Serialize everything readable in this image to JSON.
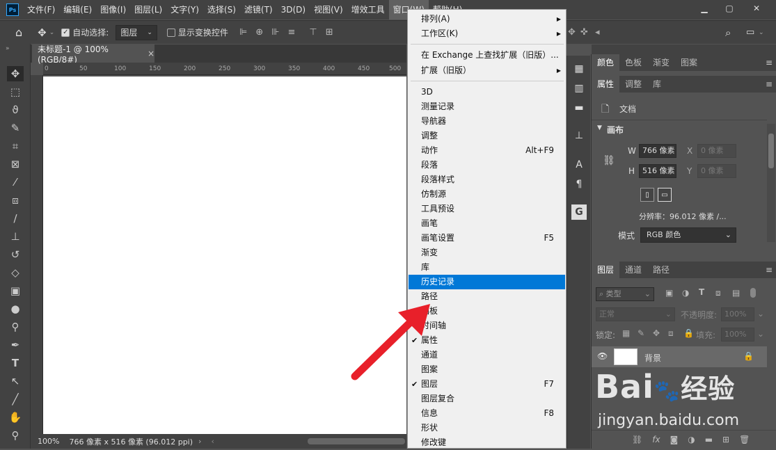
{
  "app": {
    "logo": "Ps"
  },
  "menubar": [
    "文件(F)",
    "编辑(E)",
    "图像(I)",
    "图层(L)",
    "文字(Y)",
    "选择(S)",
    "滤镜(T)",
    "3D(D)",
    "视图(V)",
    "增效工具",
    "窗口(W)",
    "帮助(H)"
  ],
  "options": {
    "auto_select_label": "自动选择:",
    "auto_select_value": "图层",
    "show_transform_label": "显示变换控件"
  },
  "document": {
    "tab_title": "未标题-1 @ 100%(RGB/8#)",
    "zoom": "100%",
    "info": "766 像素 x 516 像素 (96.012 ppi)"
  },
  "ruler": [
    "0",
    "50",
    "100",
    "150",
    "200",
    "250",
    "300",
    "350",
    "400",
    "450",
    "500"
  ],
  "window_menu": {
    "items": [
      {
        "label": "排列(A)",
        "shortcut": "",
        "submenu": true,
        "checked": false
      },
      {
        "label": "工作区(K)",
        "shortcut": "",
        "submenu": true,
        "checked": false
      },
      {
        "label": "在 Exchange 上查找扩展（旧版）...",
        "shortcut": "",
        "submenu": false,
        "checked": false
      },
      {
        "label": "扩展（旧版）",
        "shortcut": "",
        "submenu": true,
        "checked": false
      },
      {
        "label": "3D",
        "shortcut": "",
        "submenu": false,
        "checked": false
      },
      {
        "label": "测量记录",
        "shortcut": "",
        "submenu": false,
        "checked": false
      },
      {
        "label": "导航器",
        "shortcut": "",
        "submenu": false,
        "checked": false
      },
      {
        "label": "调整",
        "shortcut": "",
        "submenu": false,
        "checked": false
      },
      {
        "label": "动作",
        "shortcut": "Alt+F9",
        "submenu": false,
        "checked": false
      },
      {
        "label": "段落",
        "shortcut": "",
        "submenu": false,
        "checked": false
      },
      {
        "label": "段落样式",
        "shortcut": "",
        "submenu": false,
        "checked": false
      },
      {
        "label": "仿制源",
        "shortcut": "",
        "submenu": false,
        "checked": false
      },
      {
        "label": "工具预设",
        "shortcut": "",
        "submenu": false,
        "checked": false
      },
      {
        "label": "画笔",
        "shortcut": "",
        "submenu": false,
        "checked": false
      },
      {
        "label": "画笔设置",
        "shortcut": "F5",
        "submenu": false,
        "checked": false
      },
      {
        "label": "渐变",
        "shortcut": "",
        "submenu": false,
        "checked": false
      },
      {
        "label": "库",
        "shortcut": "",
        "submenu": false,
        "checked": false
      },
      {
        "label": "历史记录",
        "shortcut": "",
        "submenu": false,
        "checked": false,
        "highlighted": true
      },
      {
        "label": "路径",
        "shortcut": "",
        "submenu": false,
        "checked": false
      },
      {
        "label": "画板",
        "shortcut": "",
        "submenu": false,
        "checked": false
      },
      {
        "label": "时间轴",
        "shortcut": "",
        "submenu": false,
        "checked": false
      },
      {
        "label": "属性",
        "shortcut": "",
        "submenu": false,
        "checked": true
      },
      {
        "label": "通道",
        "shortcut": "",
        "submenu": false,
        "checked": false
      },
      {
        "label": "图案",
        "shortcut": "",
        "submenu": false,
        "checked": false
      },
      {
        "label": "图层",
        "shortcut": "F7",
        "submenu": false,
        "checked": true
      },
      {
        "label": "图层复合",
        "shortcut": "",
        "submenu": false,
        "checked": false
      },
      {
        "label": "信息",
        "shortcut": "F8",
        "submenu": false,
        "checked": false
      },
      {
        "label": "形状",
        "shortcut": "",
        "submenu": false,
        "checked": false
      },
      {
        "label": "修改键",
        "shortcut": "",
        "submenu": false,
        "checked": false
      }
    ]
  },
  "panels": {
    "color_tabs": [
      "颜色",
      "色板",
      "渐变",
      "图案"
    ],
    "props_tabs": [
      "属性",
      "调整",
      "库"
    ],
    "doc_label": "文档",
    "canvas_section": "画布",
    "w_label": "W",
    "w_value": "766 像素",
    "h_label": "H",
    "h_value": "516 像素",
    "x_label": "X",
    "x_value": "0 像素",
    "y_label": "Y",
    "y_value": "0 像素",
    "resolution": "分辨率：96.012 像素 /...",
    "mode_label": "模式",
    "mode_value": "RGB 颜色",
    "layers_tabs": [
      "图层",
      "通道",
      "路径"
    ],
    "filter_label": "类型",
    "blend_mode": "正常",
    "opacity_label": "不透明度:",
    "opacity_value": "100%",
    "lock_label": "锁定:",
    "fill_label": "填充:",
    "fill_value": "100%",
    "layer_name": "背景"
  },
  "watermark": {
    "brand": "Bai",
    "brand2": "经验",
    "url": "jingyan.baidu.com"
  },
  "colors": {
    "highlight": "#0078d7",
    "arrow": "#e8202a",
    "menu_bg": "#f0f0f0"
  }
}
